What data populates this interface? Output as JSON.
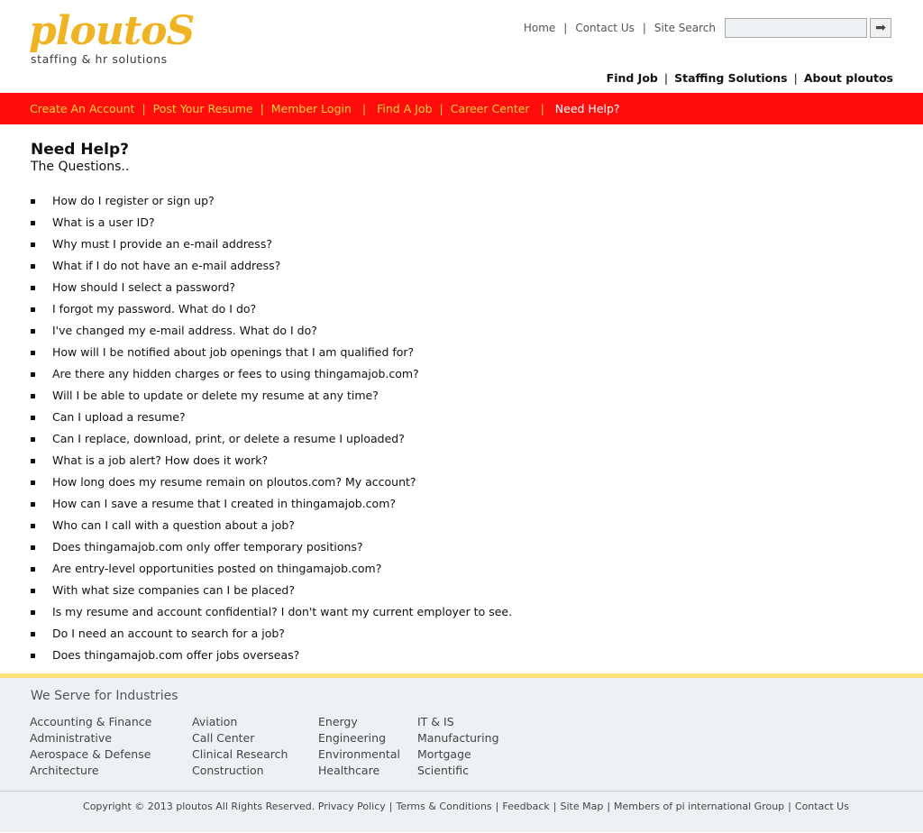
{
  "brand": {
    "logo_word": "ploutoS",
    "logo_tagline": "staffing & hr solutions",
    "logo_color": "#f0b323"
  },
  "toplinks": {
    "home": "Home",
    "contact": "Contact Us",
    "site_search": "Site Search",
    "search_value": ""
  },
  "mainnav": {
    "find_job": "Find Job",
    "staffing": "Staffing Solutions",
    "about": "About ploutos"
  },
  "subnav": {
    "bg_color": "#ff0d0d",
    "link_color": "#ffd13a",
    "items": [
      "Create An Account",
      "Post Your Resume",
      "Member Login",
      "Find A Job",
      "Career Center",
      "Need Help?"
    ],
    "active": "Need Help?"
  },
  "content": {
    "title": "Need Help?",
    "subtitle": "The Questions..",
    "questions": [
      "How do I register or sign up?",
      "What is a user ID?",
      "Why must I provide an e-mail address?",
      "What if I do not have an e-mail address?",
      "How should I select a password?",
      "I forgot my password. What do I do?",
      "I've changed my e-mail address. What do I do?",
      "How will I be notified about job openings that I am qualified for?",
      "Are there any hidden charges or fees to using thingamajob.com?",
      "Will I be able to update or delete my resume at any time?",
      "Can I upload a resume?",
      "Can I replace, download, print, or delete a resume I uploaded?",
      "What is a job alert? How does it work?",
      "How long does my resume remain on ploutos.com? My account?",
      "How can I save a resume that I created in thingamajob.com?",
      "Who can I call with a question about a job?",
      "Does thingamajob.com only offer temporary positions?",
      "Are entry-level opportunities posted on thingamajob.com?",
      "With what size companies can I be placed?",
      "Is my resume and account confidential? I don't want my current employer to see.",
      "Do I need an account to search for a job?",
      "Does thingamajob.com offer jobs overseas?"
    ]
  },
  "footer": {
    "industries_title": "We Serve for Industries",
    "columns": [
      [
        "Accounting & Finance",
        "Administrative",
        "Aerospace & Defense",
        "Architecture"
      ],
      [
        "Aviation",
        "Call Center",
        "Clinical Research",
        "Construction"
      ],
      [
        "Energy",
        "Engineering",
        "Environmental",
        "Healthcare"
      ],
      [
        "IT & IS",
        "Manufacturing",
        "Mortgage",
        "Scientific"
      ]
    ],
    "copyright": "Copyright © 2013 ploutos All Rights Reserved.",
    "links": [
      "Privacy Policy",
      "Terms & Conditions",
      "Feedback",
      "Site Map",
      "Members of pi international Group",
      "Contact Us"
    ]
  }
}
